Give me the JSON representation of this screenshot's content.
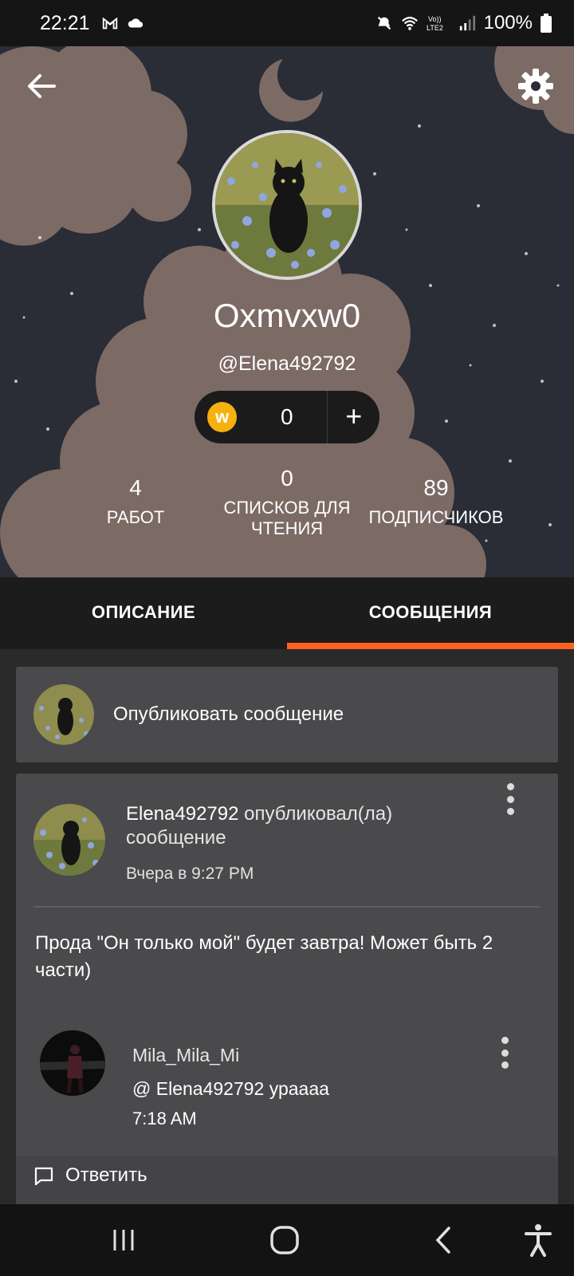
{
  "status_bar": {
    "time": "22:21",
    "battery": "100%",
    "icons": [
      "gmail-icon",
      "cloud-icon",
      "mute-icon",
      "wifi-icon",
      "volte-icon",
      "signal-icon",
      "battery-icon"
    ]
  },
  "profile": {
    "display_name": "Oxmvxw0",
    "username": "@Elena492792",
    "coins": "0",
    "stats": [
      {
        "value": "4",
        "label": "РАБОТ"
      },
      {
        "value": "0",
        "label": "СПИСКОВ ДЛЯ ЧТЕНИЯ"
      },
      {
        "value": "89",
        "label": "ПОДПИСЧИКОВ"
      }
    ]
  },
  "tabs": [
    {
      "label": "ОПИСАНИЕ",
      "active": false
    },
    {
      "label": "СООБЩЕНИЯ",
      "active": true
    }
  ],
  "colors": {
    "accent": "#ff6122",
    "card": "#4a494c",
    "coin": "#f6b10f"
  },
  "post_prompt": {
    "label": "Опубликовать сообщение"
  },
  "message": {
    "author": "Elena492792",
    "action": "опубликовал(ла) сообщение",
    "time": "Вчера в 9:27 PM",
    "body": "Прода \"Он только мой\" будет завтра! Может быть 2 части)",
    "reply": {
      "author": "Mila_Mila_Mi",
      "text": "@ Elena492792  ураааа",
      "time": "7:18 AM"
    },
    "reply_button": "Ответить"
  }
}
